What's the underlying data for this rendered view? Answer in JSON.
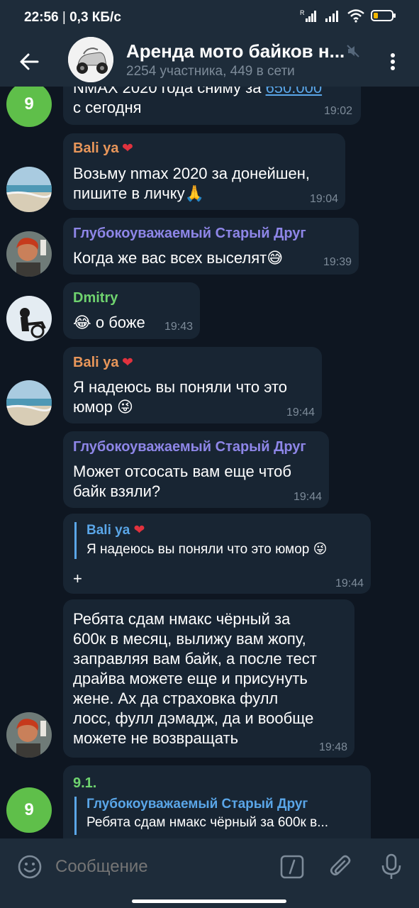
{
  "status_bar": {
    "time": "22:56",
    "network_speed": "0,3 КБ/с",
    "battery_level": 0.25
  },
  "header": {
    "title": "Аренда мото байков н...",
    "subtitle": "2254 участника, 449 в сети",
    "back_icon": "arrow-left-icon",
    "mute_icon": "muted-speaker-icon",
    "menu_icon": "more-vertical-icon"
  },
  "messages": [
    {
      "avatar_letter": "9",
      "text_prefix": "NMAX 2020 года сниму за ",
      "link": "650.000",
      "text_suffix": "с сегодня",
      "time": "19:02"
    },
    {
      "sender": "Bali ya",
      "sender_color": "#e8965a",
      "text": "Возьму nmax 2020 за донейшен,\nпишите в личку",
      "emoji": "🙏",
      "time": "19:04"
    },
    {
      "sender": "Глубокоуважаемый Старый Друг",
      "sender_color": "#8e86e8",
      "text": "Когда же вас всех выселят",
      "emoji": "😅",
      "time": "19:39"
    },
    {
      "sender": "Dmitry",
      "sender_color": "#6fd36f",
      "emoji": "😂",
      "text": "о боже",
      "time": "19:43"
    },
    {
      "sender": "Bali ya",
      "sender_color": "#e8965a",
      "text": "Я надеюсь вы поняли что это\nюмор",
      "emoji": "😜",
      "time": "19:44"
    },
    {
      "sender": "Глубокоуважаемый Старый Друг",
      "sender_color": "#8e86e8",
      "text": "Может отсосать вам еще чтоб\nбайк взяли?",
      "time": "19:44"
    },
    {
      "reply_name": "Bali ya",
      "reply_text": "Я надеюсь вы поняли что это юмор",
      "reply_emoji": "😜",
      "text": "+",
      "time": "19:44"
    },
    {
      "text": "Ребята сдам нмакс чёрный за\n600к в месяц, вылижу вам жопу,\nзаправляя вам байк, а после тест\nдрайва можете еще и присунуть\nжене. Ах да страховка  фулл\nлосс, фулл дэмадж, да и вообще\nможете не возвращать",
      "time": "19:48"
    },
    {
      "avatar_letter": "9",
      "sender": "9.1.",
      "sender_color": "#6fd36f",
      "reply_name": "Глубокоуважаемый Старый Друг",
      "reply_text": "Ребята сдам нмакс чёрный за 600к в..."
    }
  ],
  "input": {
    "placeholder": "Сообщение"
  },
  "colors": {
    "header_bg": "#1e2c3a",
    "chat_bg": "#0e1621",
    "bubble_bg": "#182533",
    "accent": "#5aa6e8",
    "letter_avatar": "#5fbf4a"
  }
}
